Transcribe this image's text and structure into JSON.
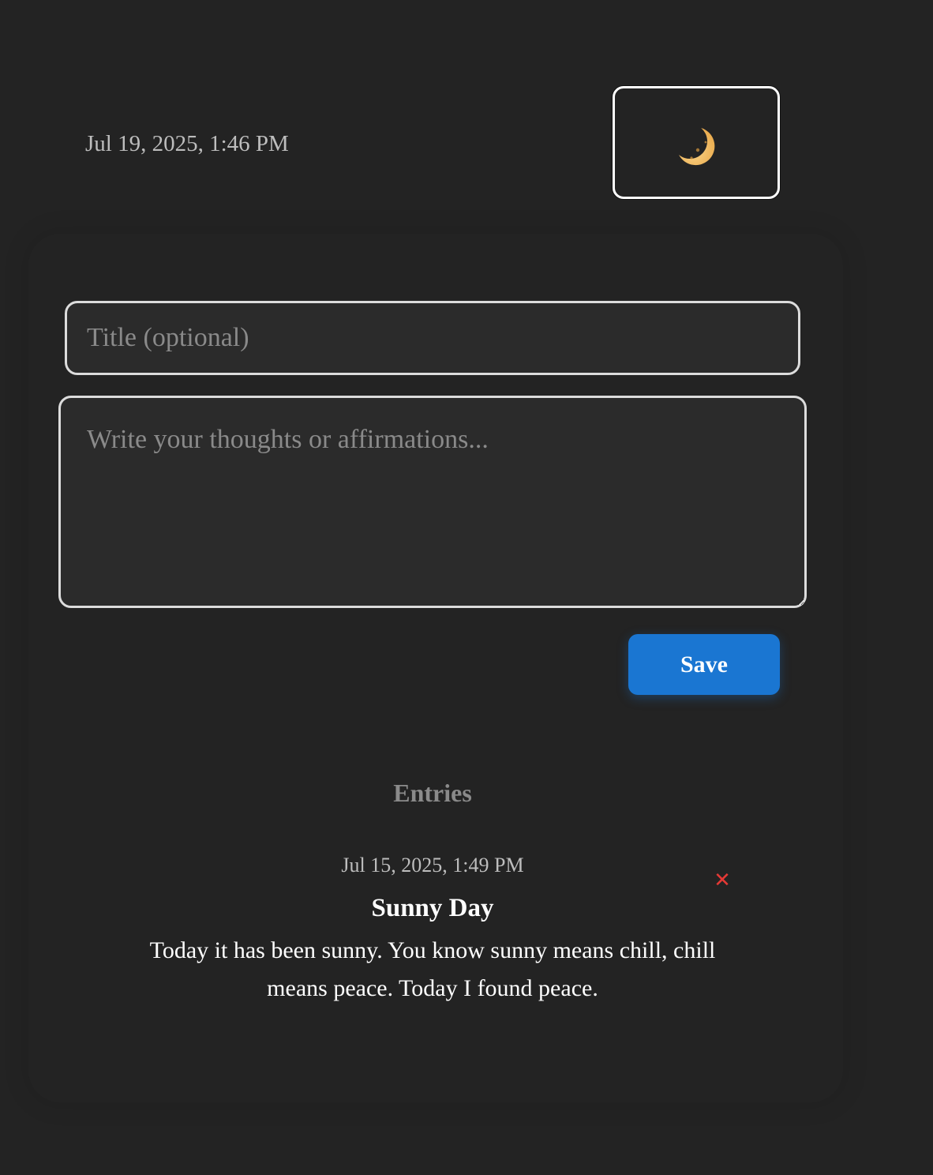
{
  "header": {
    "current_datetime": "Jul 19, 2025, 1:46 PM",
    "theme_toggle_icon": "crescent-moon-icon"
  },
  "editor": {
    "title_placeholder": "Title (optional)",
    "title_value": "",
    "body_placeholder": "Write your thoughts or affirmations...",
    "body_value": "",
    "save_label": "Save"
  },
  "entries": {
    "heading": "Entries",
    "items": [
      {
        "date": "Jul 15, 2025, 1:49 PM",
        "title": "Sunny Day",
        "body": "Today it has been sunny. You know sunny means chill, chill means peace. Today I found peace.",
        "delete_label": "✕"
      }
    ]
  },
  "colors": {
    "background": "#232323",
    "input_background": "#2b2b2b",
    "accent": "#1a76d2",
    "delete": "#e53935",
    "moon": "#f4c06a"
  }
}
